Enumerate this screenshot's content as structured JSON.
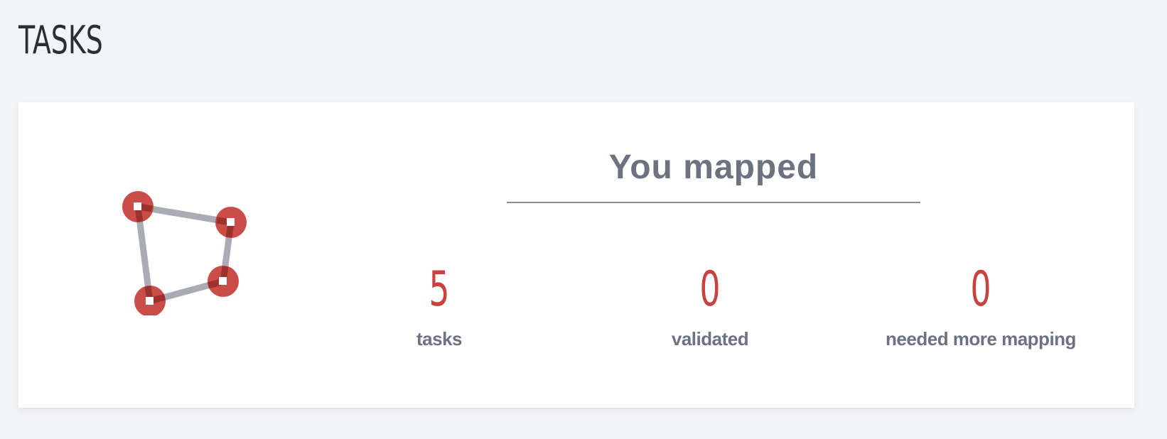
{
  "page": {
    "title": "TASKS"
  },
  "summary": {
    "icon": "task-polygon-icon",
    "headline": "You mapped",
    "stats": [
      {
        "value": "5",
        "label": "tasks"
      },
      {
        "value": "0",
        "label": "validated"
      },
      {
        "value": "0",
        "label": "needed more mapping"
      }
    ]
  },
  "colors": {
    "accent": "#c8433f",
    "text_muted": "#6b7280",
    "title": "#2c2e33",
    "background": "#f3f4f6",
    "card": "#ffffff"
  }
}
